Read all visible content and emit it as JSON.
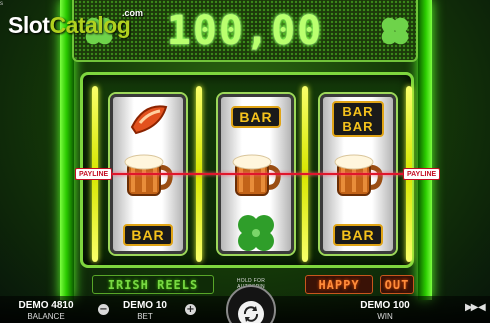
{
  "branding": {
    "logo_word_1": "Slot",
    "logo_word_2": "Catalog",
    "logo_suffix": ".com",
    "corner_mark": "s"
  },
  "display": {
    "win_amount": "100,00"
  },
  "reels": {
    "payline_label": "PAYLINE",
    "columns": [
      [
        "cherry-partial",
        "beer-mug",
        "BAR"
      ],
      [
        "BAR",
        "beer-mug",
        "four-leaf-clover"
      ],
      [
        "BAR BAR",
        "beer-mug",
        "BAR"
      ]
    ]
  },
  "deck": {
    "irish_reels": "IRISH REELS",
    "happy": "HAPPY",
    "out": "OUT"
  },
  "hud": {
    "balance_value": "DEMO 4810",
    "balance_label": "BALANCE",
    "bet_value": "DEMO 10",
    "bet_label": "BET",
    "win_value": "DEMO 100",
    "win_label": "WIN",
    "hold_hint": "HOLD FOR AUTOSPIN",
    "minus_symbol": "−",
    "plus_symbol": "+"
  },
  "colors": {
    "neon_green": "#7dff40",
    "display_green": "#b9ff6e",
    "payline_red": "#e0162c",
    "bar_gold": "#f5c21c"
  }
}
